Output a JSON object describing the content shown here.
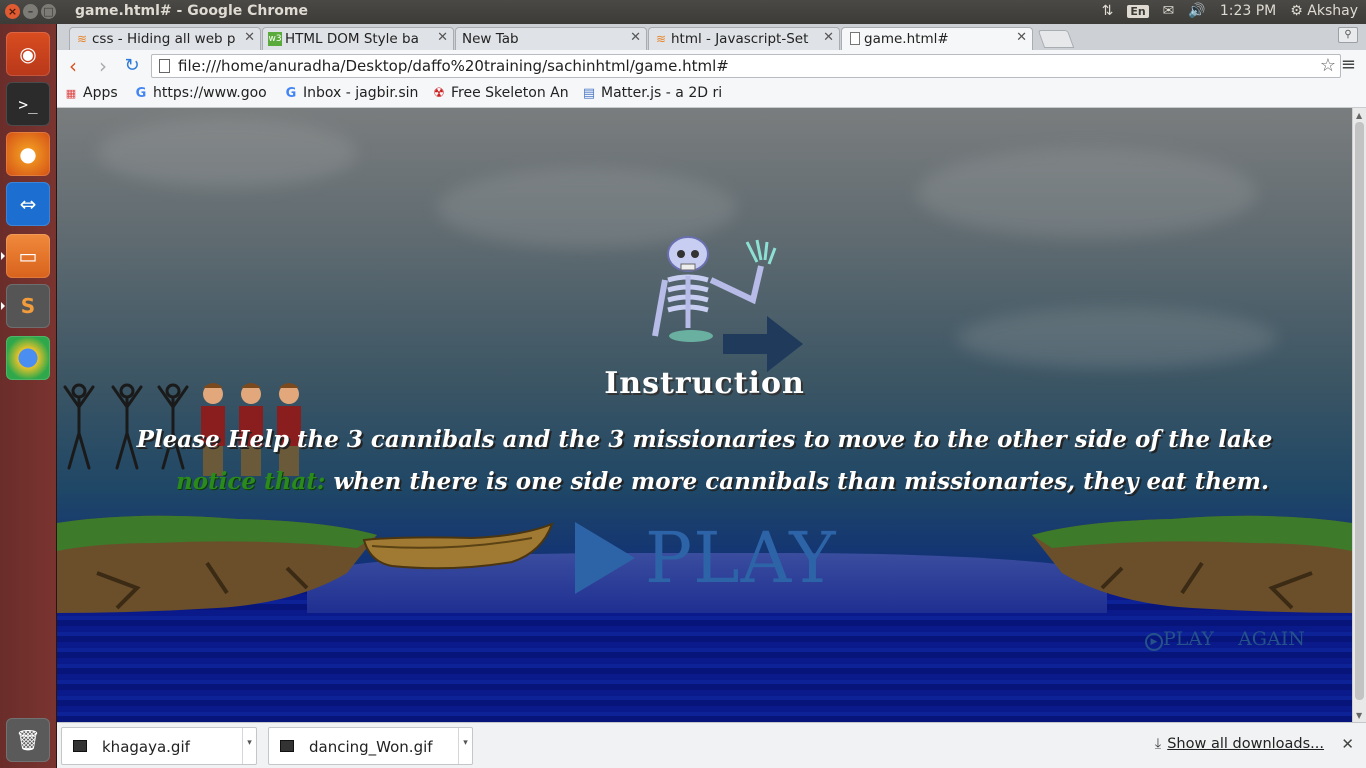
{
  "system": {
    "window_title": "game.html# - Google Chrome",
    "lang": "En",
    "time": "1:23 PM",
    "user": "Akshay"
  },
  "tabs": [
    {
      "label": "css - Hiding all web p",
      "icon": "stackoverflow-icon"
    },
    {
      "label": "HTML DOM Style ba",
      "icon": "w3schools-icon"
    },
    {
      "label": "New Tab",
      "icon": "none"
    },
    {
      "label": "html - Javascript-Set",
      "icon": "stackoverflow-icon"
    },
    {
      "label": "game.html#",
      "icon": "page-icon"
    }
  ],
  "address": {
    "url": "file:///home/anuradha/Desktop/daffo%20training/sachinhtml/game.html#"
  },
  "bookmarks": [
    {
      "label": "Apps"
    },
    {
      "label": "https://www.goo"
    },
    {
      "label": "Inbox - jagbir.sin"
    },
    {
      "label": "Free Skeleton An"
    },
    {
      "label": "Matter.js - a 2D ri"
    }
  ],
  "game": {
    "instruction_title": "Instruction",
    "line1": "Please Help the 3 cannibals and the 3 missionaries to move to the other side of the lake",
    "notice": "notice that:",
    "line2": "when there is one side more cannibals than missionaries, they eat them.",
    "play_label": "PLAY",
    "play_again_1": "PLAY",
    "play_again_2": "AGAIN"
  },
  "downloads": {
    "items": [
      {
        "label": "khagaya.gif"
      },
      {
        "label": "dancing_Won.gif"
      }
    ],
    "show_all": "Show all downloads..."
  }
}
